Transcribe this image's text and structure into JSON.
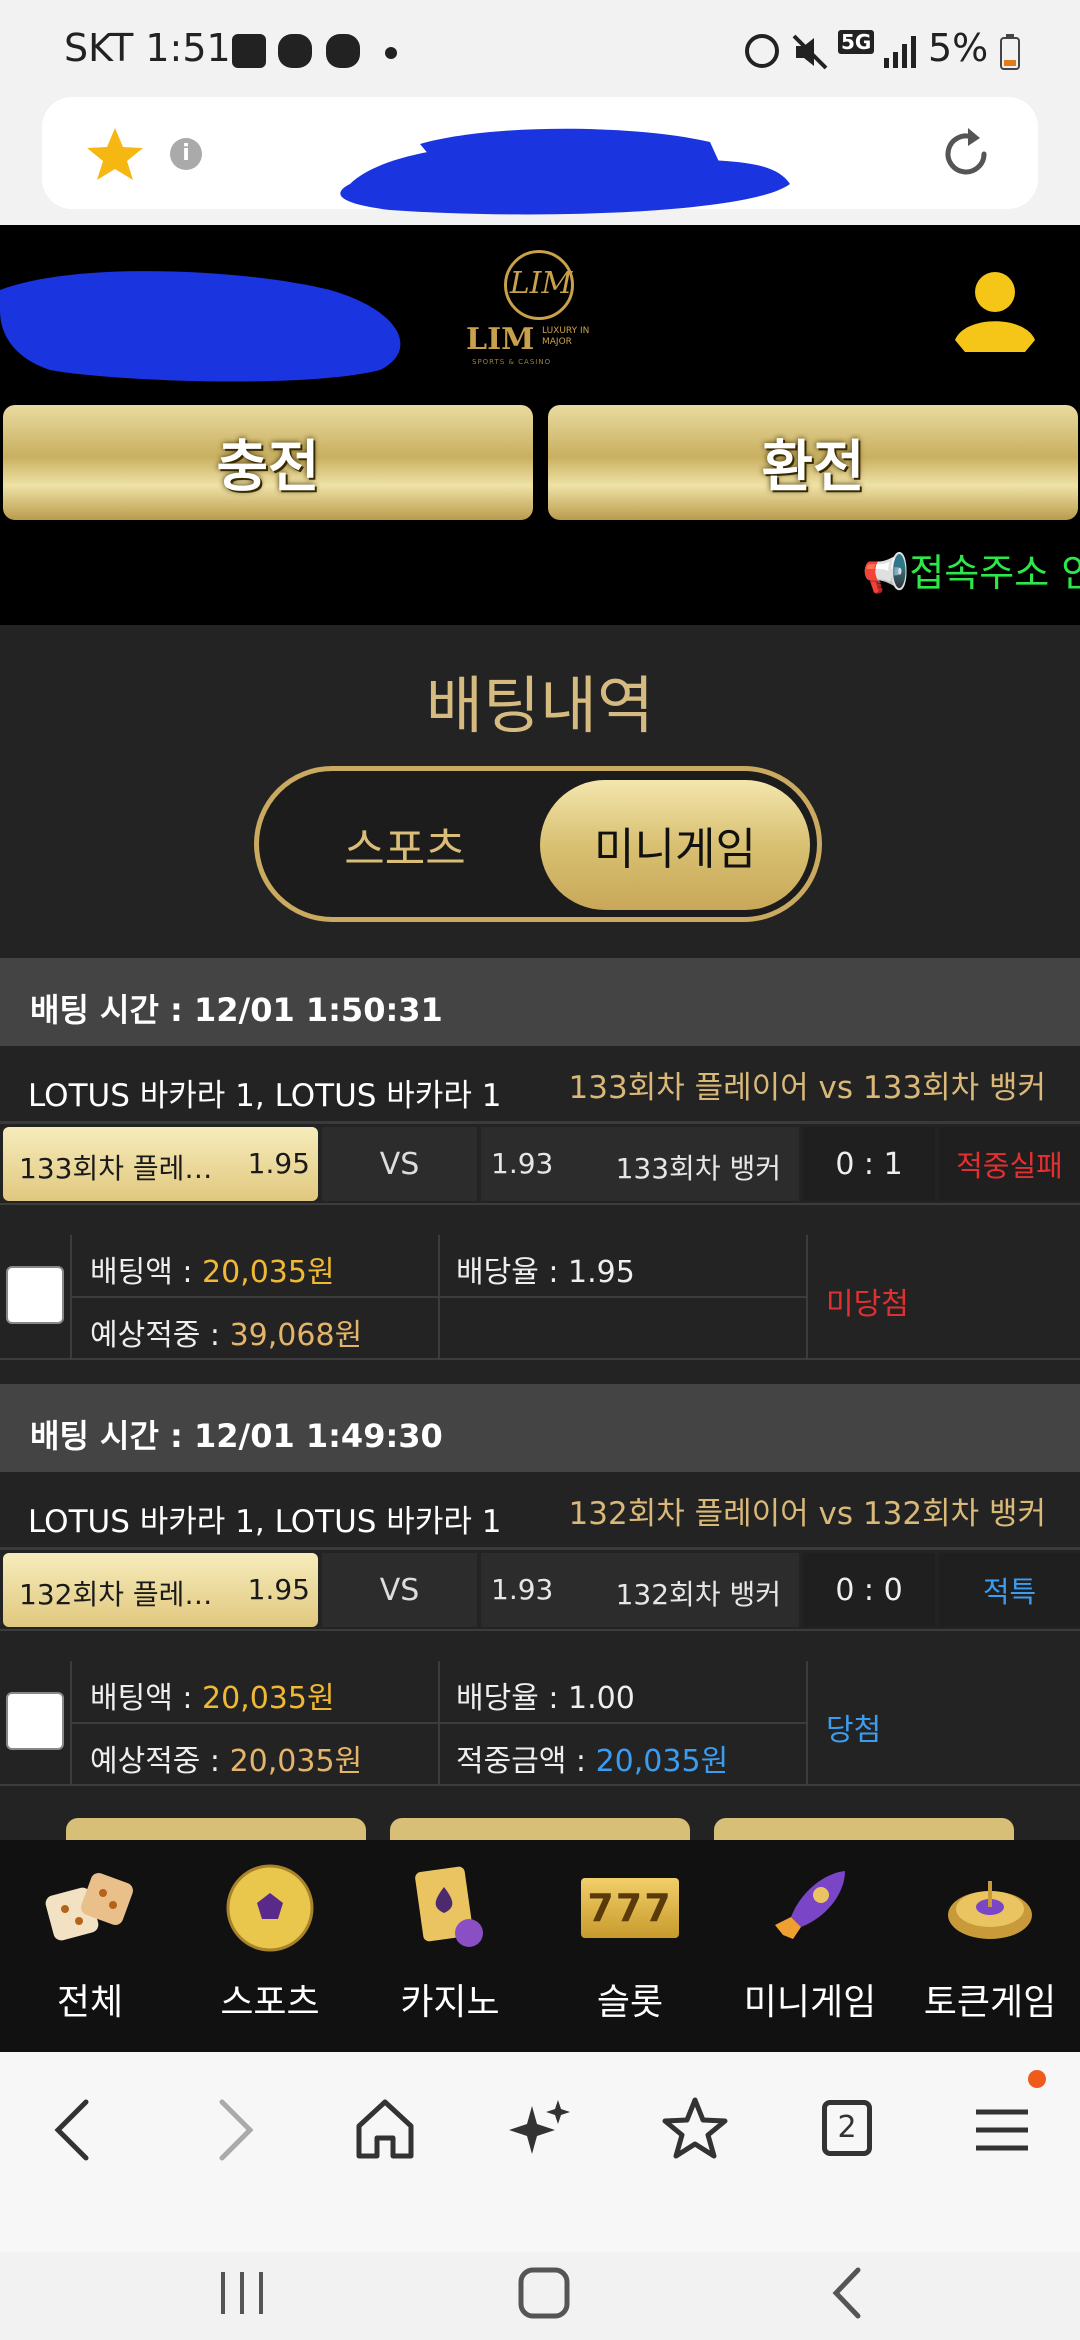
{
  "status_bar": {
    "carrier_time": "SKT 1:51",
    "battery": "5%",
    "network": "5G"
  },
  "browser": {
    "star_icon": "star-icon",
    "info_icon": "info-icon",
    "reload_icon": "reload-icon",
    "tab_count": "2"
  },
  "site": {
    "logo_text": "LIM",
    "logo_sub": "LUXURY IN MAJOR",
    "logo_tag": "SPORTS & CASINO",
    "charge_label": "충전",
    "exchange_label": "환전",
    "notice": "📢접속주소 안"
  },
  "history": {
    "title": "배팅내역",
    "tabs": {
      "sports": "스포츠",
      "minigame": "미니게임"
    },
    "bets": [
      {
        "time": "배팅 시간 : 12/01 1:50:31",
        "game": "LOTUS 바카라 1, LOTUS 바카라 1",
        "match": "133회차 플레이어  vs  133회차 뱅커",
        "home_name": "133회차 플레…",
        "home_odds": "1.95",
        "vs": "VS",
        "away_odds": "1.93",
        "away_name": "133회차 뱅커",
        "score": "0 : 1",
        "result": "적중실패",
        "bet_label": "배팅액 : ",
        "bet_amount": "20,035원",
        "rate_label": "배당율 : ",
        "rate": "1.95",
        "expected_label": "예상적중 : ",
        "expected": "39,068원",
        "win_label": "",
        "win_amount": "",
        "status": "미당첨"
      },
      {
        "time": "배팅 시간 : 12/01 1:49:30",
        "game": "LOTUS 바카라 1, LOTUS 바카라 1",
        "match": "132회차 플레이어  vs  132회차 뱅커",
        "home_name": "132회차 플레…",
        "home_odds": "1.95",
        "vs": "VS",
        "away_odds": "1.93",
        "away_name": "132회차 뱅커",
        "score": "0 : 0",
        "result": "적특",
        "bet_label": "배팅액 : ",
        "bet_amount": "20,035원",
        "rate_label": "배당율 : ",
        "rate": "1.00",
        "expected_label": "예상적중 : ",
        "expected": "20,035원",
        "win_label": "적중금액 : ",
        "win_amount": "20,035원",
        "status": "당첨"
      }
    ]
  },
  "game_nav": [
    {
      "label": "전체",
      "icon": "dice-icon"
    },
    {
      "label": "스포츠",
      "icon": "soccer-ball-icon"
    },
    {
      "label": "카지노",
      "icon": "cards-icon"
    },
    {
      "label": "슬롯",
      "icon": "slot-777-icon"
    },
    {
      "label": "미니게임",
      "icon": "rocket-icon"
    },
    {
      "label": "토큰게임",
      "icon": "roulette-icon"
    }
  ],
  "slot_text": "777",
  "colors": {
    "gold": "#d6bb80",
    "loss_red": "#e23030",
    "win_blue": "#3c9cf0",
    "amount_gold": "#f1b833",
    "notice_green": "#2ee84a"
  }
}
